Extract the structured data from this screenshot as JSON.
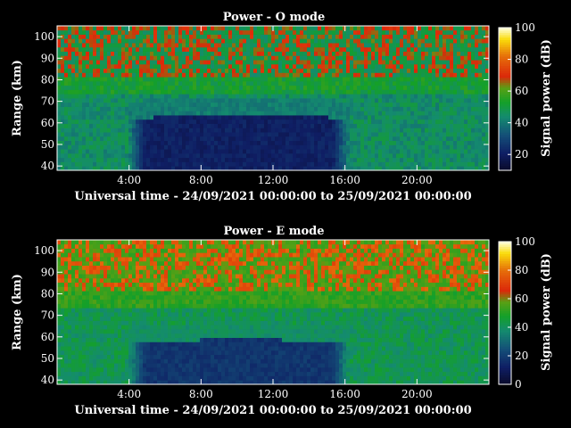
{
  "chart_data": [
    {
      "type": "heatmap",
      "title": "Power - O mode",
      "xlabel": "Universal time - 24/09/2021 00:00:00 to 25/09/2021 00:00:00",
      "ylabel": "Range (km)",
      "colorbar_label": "Signal power (dB)",
      "x_ticks": [
        "4:00",
        "8:00",
        "12:00",
        "16:00",
        "20:00"
      ],
      "x_tick_hours": [
        4,
        8,
        12,
        16,
        20
      ],
      "xlim_hours": [
        0,
        24
      ],
      "y_ticks": [
        40,
        50,
        60,
        70,
        80,
        90,
        100
      ],
      "ylim": [
        38,
        105
      ],
      "colorbar_ticks": [
        20,
        40,
        60,
        80,
        100
      ],
      "colorbar_range": [
        10,
        100
      ],
      "description_values": {
        "night_level_db": 45,
        "daytime_lower_layer_db": 18,
        "daytime_boundary_km": 60,
        "upper_echo_peak_db": 68
      }
    },
    {
      "type": "heatmap",
      "title": "Power - E mode",
      "xlabel": "Universal time - 24/09/2021 00:00:00 to 25/09/2021 00:00:00",
      "ylabel": "Range (km)",
      "colorbar_label": "Signal power (dB)",
      "x_ticks": [
        "4:00",
        "8:00",
        "12:00",
        "16:00",
        "20:00"
      ],
      "x_tick_hours": [
        4,
        8,
        12,
        16,
        20
      ],
      "xlim_hours": [
        0,
        24
      ],
      "y_ticks": [
        40,
        50,
        60,
        70,
        80,
        90,
        100
      ],
      "ylim": [
        38,
        105
      ],
      "colorbar_ticks": [
        0,
        20,
        40,
        60,
        80,
        100
      ],
      "colorbar_range": [
        0,
        100
      ],
      "description_values": {
        "night_level_db": 42,
        "daytime_lower_layer_db": 15,
        "daytime_boundary_km": 55,
        "upper_echo_peak_db": 75
      }
    }
  ],
  "colors": {
    "background": "#000000",
    "text": "#ffffff"
  }
}
